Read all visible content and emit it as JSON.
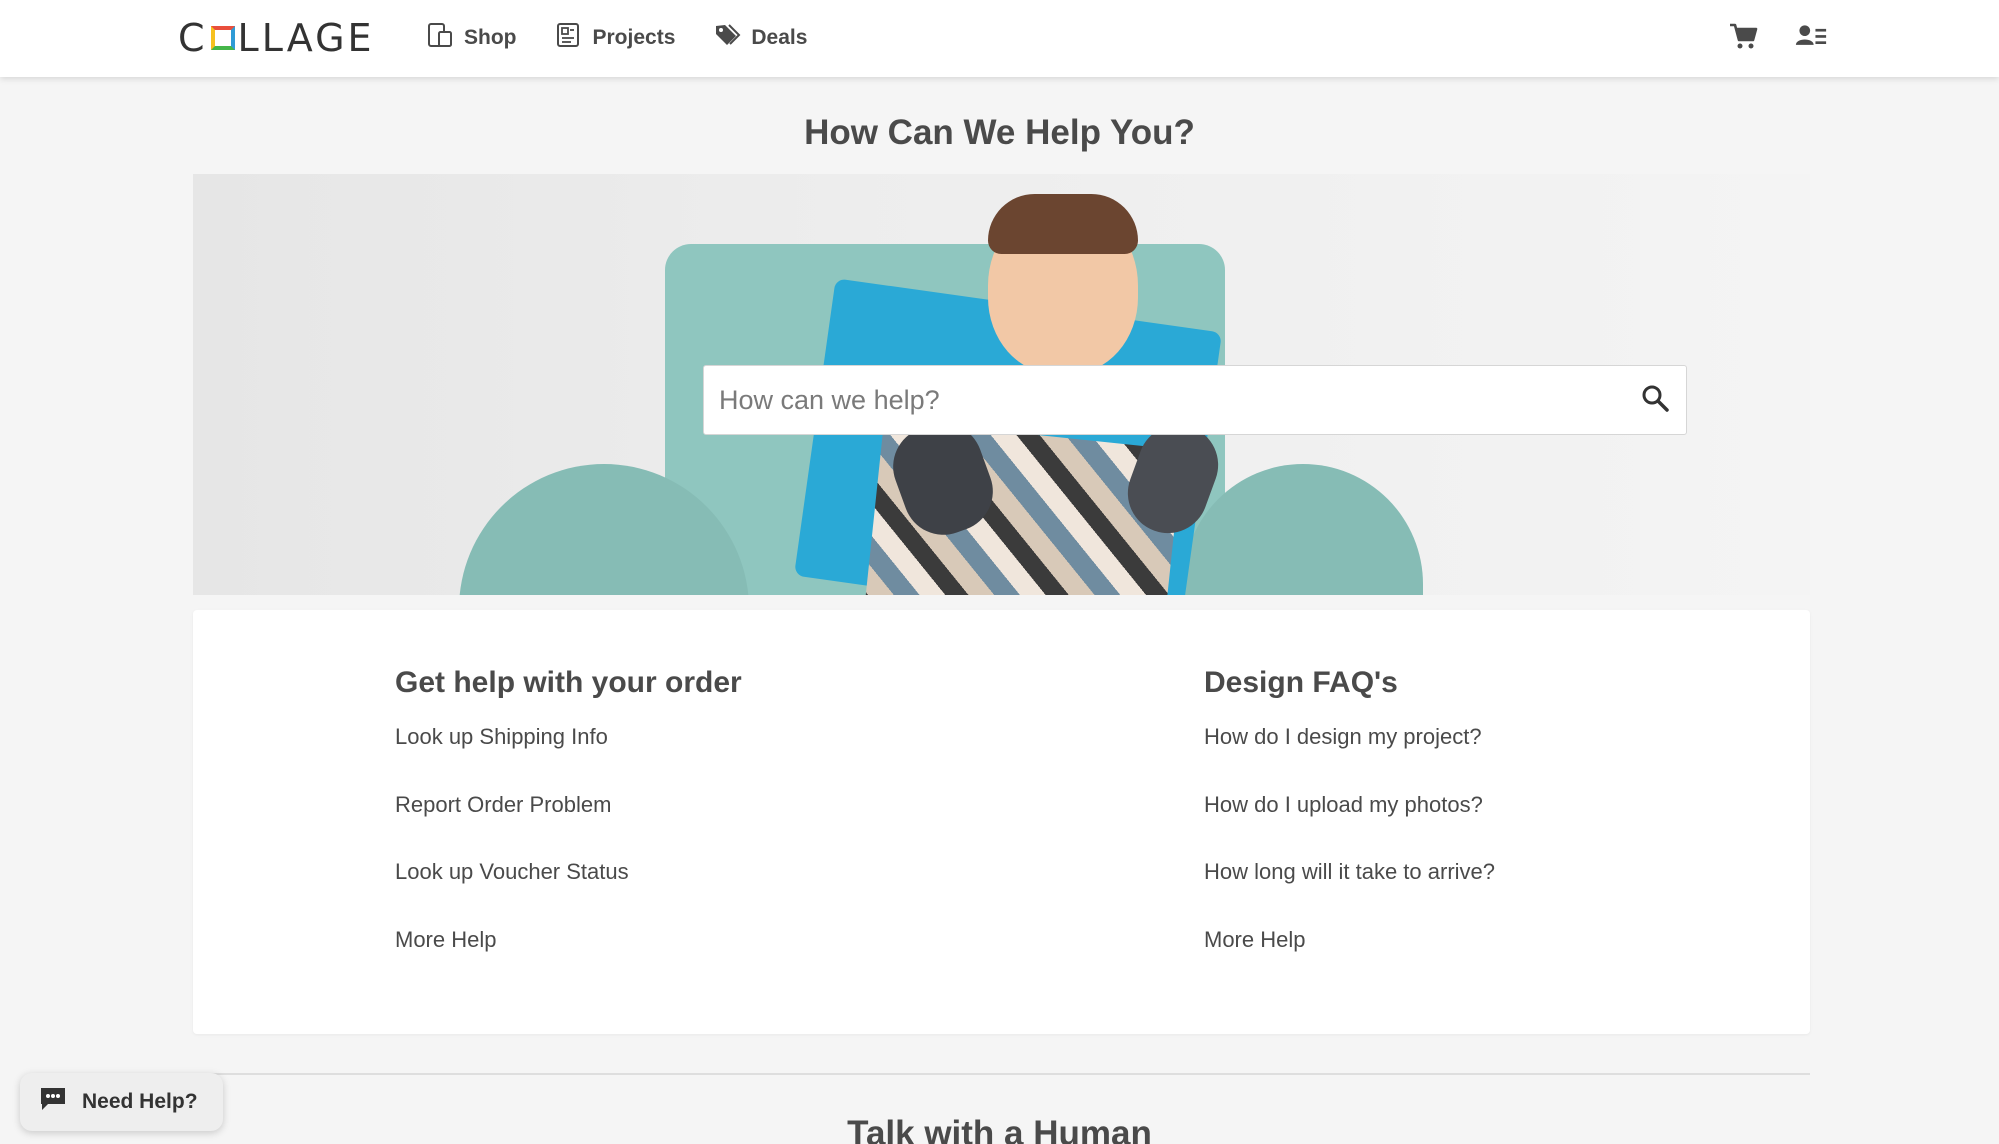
{
  "header": {
    "logo_text": "COLLAGE",
    "nav": [
      {
        "label": "Shop",
        "icon": "shop-icon"
      },
      {
        "label": "Projects",
        "icon": "projects-icon"
      },
      {
        "label": "Deals",
        "icon": "tag-icon"
      }
    ],
    "icons": [
      "cart-icon",
      "account-icon"
    ]
  },
  "page": {
    "title": "How Can We Help You?"
  },
  "search": {
    "placeholder": "How can we help?",
    "value": ""
  },
  "order_help": {
    "heading": "Get help with your order",
    "links": [
      "Look up Shipping Info",
      "Report Order Problem",
      "Look up Voucher Status",
      "More Help"
    ]
  },
  "design_faq": {
    "heading": "Design FAQ's",
    "links": [
      "How do I design my project?",
      "How do I upload my photos?",
      "How long will it take to arrive?",
      "More Help"
    ]
  },
  "talk": {
    "title": "Talk with a Human"
  },
  "chat": {
    "label": "Need Help?"
  },
  "colors": {
    "accent_text": "#4a4a4a",
    "background": "#f5f5f5",
    "logo_red": "#e94e3c",
    "logo_blue": "#2e9bd6",
    "logo_green": "#45b649",
    "logo_yellow": "#f6c11f"
  }
}
